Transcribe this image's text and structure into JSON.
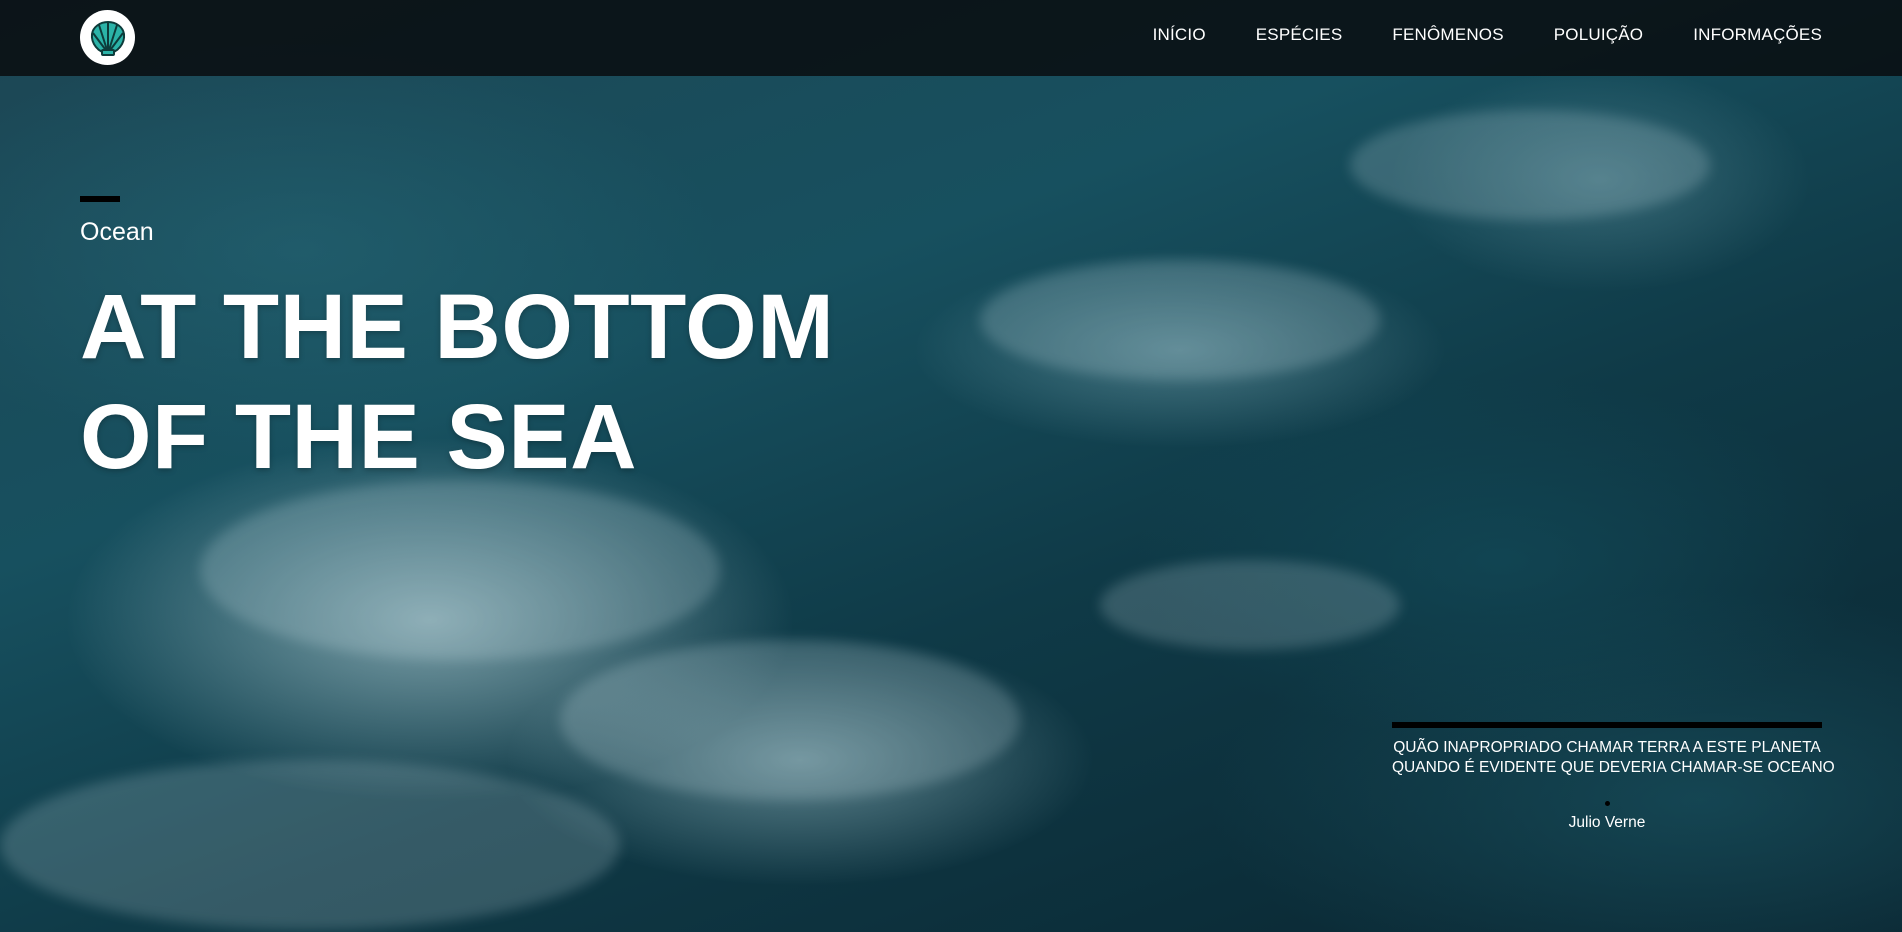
{
  "nav": {
    "items": [
      {
        "label": "INÍCIO"
      },
      {
        "label": "ESPÉCIES"
      },
      {
        "label": "FENÔMENOS"
      },
      {
        "label": "POLUIÇÃO"
      },
      {
        "label": "INFORMAÇÕES"
      }
    ],
    "logo_icon": "seashell-icon",
    "logo_color": "#2bb3a8"
  },
  "hero": {
    "eyebrow": "Ocean",
    "headline_line1": "AT THE BOTTOM",
    "headline_line2": "OF THE SEA",
    "background": "ocean-waves-photo"
  },
  "quote": {
    "line1": "QUÃO INAPROPRIADO CHAMAR TERRA A ESTE PLANETA",
    "line2": "QUANDO É EVIDENTE QUE DEVERIA CHAMAR-SE OCEANO",
    "author": "Julio Verne"
  },
  "colors": {
    "nav_bg": "#0b0d0f",
    "accent_bar": "#000000",
    "text": "#ffffff"
  }
}
